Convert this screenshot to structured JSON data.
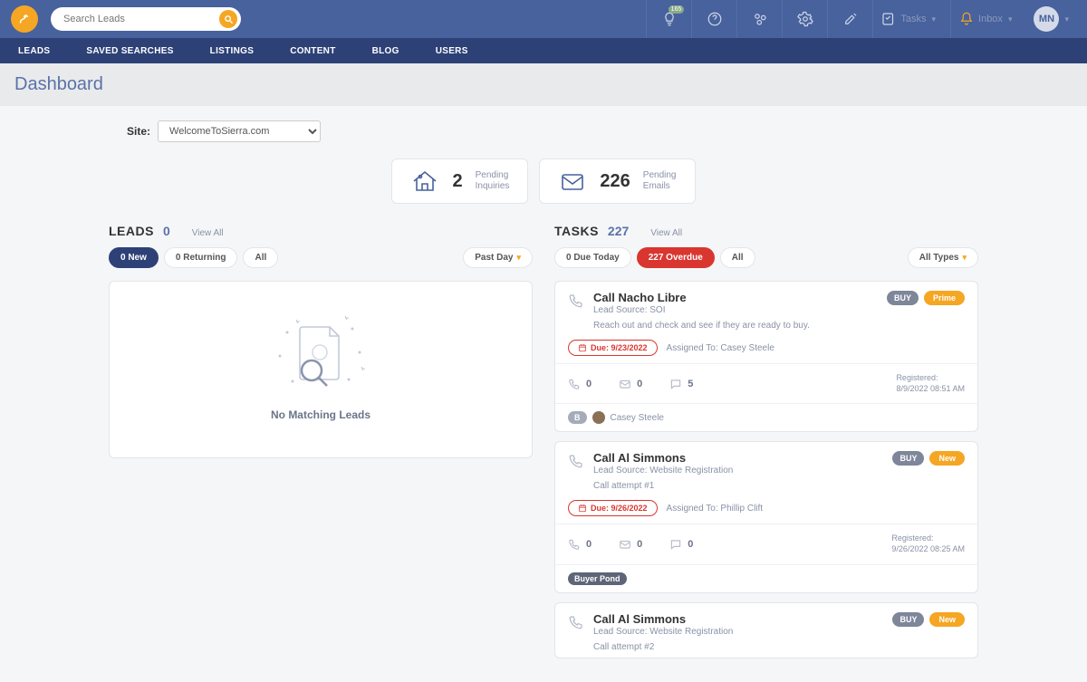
{
  "search": {
    "placeholder": "Search Leads"
  },
  "topbar": {
    "tasks_label": "Tasks",
    "inbox_label": "Inbox",
    "avatar_initials": "MN",
    "notif_badge": "165"
  },
  "nav": [
    "LEADS",
    "SAVED SEARCHES",
    "LISTINGS",
    "CONTENT",
    "BLOG",
    "USERS"
  ],
  "page_title": "Dashboard",
  "site": {
    "label": "Site:",
    "value": "WelcomeToSierra.com"
  },
  "stats": {
    "inquiries": {
      "count": "2",
      "label1": "Pending",
      "label2": "Inquiries"
    },
    "emails": {
      "count": "226",
      "label1": "Pending",
      "label2": "Emails"
    }
  },
  "leads": {
    "heading": "LEADS",
    "count": "0",
    "view_all": "View All",
    "pills": {
      "new": "0 New",
      "returning": "0 Returning",
      "all": "All",
      "past_day": "Past Day"
    },
    "empty_msg": "No Matching Leads"
  },
  "tasks": {
    "heading": "TASKS",
    "count": "227",
    "view_all": "View All",
    "pills": {
      "due_today": "0 Due Today",
      "overdue": "227 Overdue",
      "all": "All",
      "all_types": "All Types"
    },
    "items": [
      {
        "title": "Call Nacho Libre",
        "source": "Lead Source: SOI",
        "note": "Reach out and check and see if they are ready to buy.",
        "due": "Due: 9/23/2022",
        "assigned": "Assigned To: Casey Steele",
        "badge1": "BUY",
        "badge2": "Prime",
        "stat_phone": "0",
        "stat_mail": "0",
        "stat_chat": "5",
        "reg_label": "Registered:",
        "reg_time": "8/9/2022 08:51 AM",
        "foot_chip": "B",
        "foot_name": "Casey Steele"
      },
      {
        "title": "Call Al Simmons",
        "source": "Lead Source: Website Registration",
        "note": "Call attempt #1",
        "due": "Due: 9/26/2022",
        "assigned": "Assigned To: Phillip Clift",
        "badge1": "BUY",
        "badge2": "New",
        "stat_phone": "0",
        "stat_mail": "0",
        "stat_chat": "0",
        "reg_label": "Registered:",
        "reg_time": "9/26/2022 08:25 AM",
        "foot_chip": "Buyer Pond",
        "foot_name": ""
      },
      {
        "title": "Call Al Simmons",
        "source": "Lead Source: Website Registration",
        "note": "Call attempt #2",
        "due": "",
        "assigned": "",
        "badge1": "BUY",
        "badge2": "New",
        "stat_phone": "",
        "stat_mail": "",
        "stat_chat": "",
        "reg_label": "",
        "reg_time": "",
        "foot_chip": "",
        "foot_name": ""
      }
    ]
  }
}
